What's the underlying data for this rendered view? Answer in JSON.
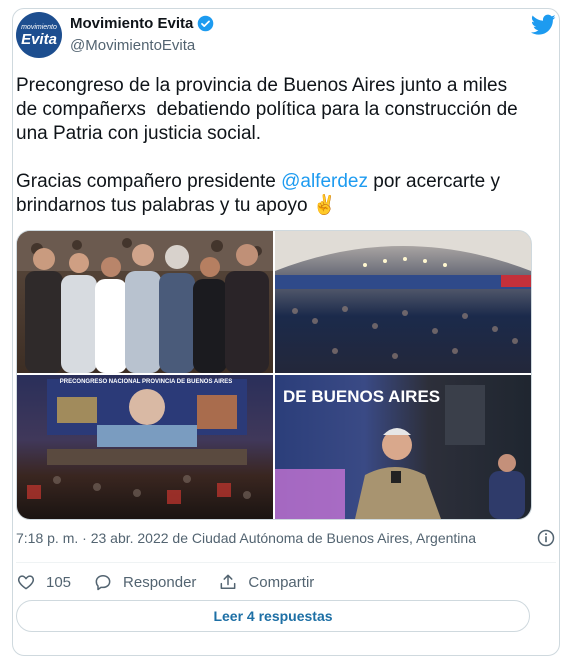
{
  "author": {
    "avatar_top": "movimiento",
    "avatar_bottom": "Evita",
    "name": "Movimiento Evita",
    "handle": "@MovimientoEvita"
  },
  "tweet": {
    "line1": "Precongreso de la provincia de Buenos Aires junto a miles de compañerxs  debatiendo política para la construcción de una Patria con justicia social.",
    "line2_pre": "Gracias compañero presidente ",
    "mention": "@alferdez",
    "line2_post": " por acercarte y brindarnos tus palabras y tu apoyo ✌️"
  },
  "photos": {
    "p3_banner": "PRECONGRESO NACIONAL PROVINCIA DE BUENOS AIRES",
    "p4_banner": "DE BUENOS AIRES"
  },
  "meta": {
    "timestamp": "7:18 p. m. · 23 abr. 2022 de Ciudad Autónoma de Buenos Aires, Argentina"
  },
  "actions": {
    "likes": "105",
    "reply": "Responder",
    "share": "Compartir"
  },
  "read_replies": "Leer 4 respuestas",
  "colors": {
    "accent": "#1d9bf0",
    "muted": "#536471"
  }
}
